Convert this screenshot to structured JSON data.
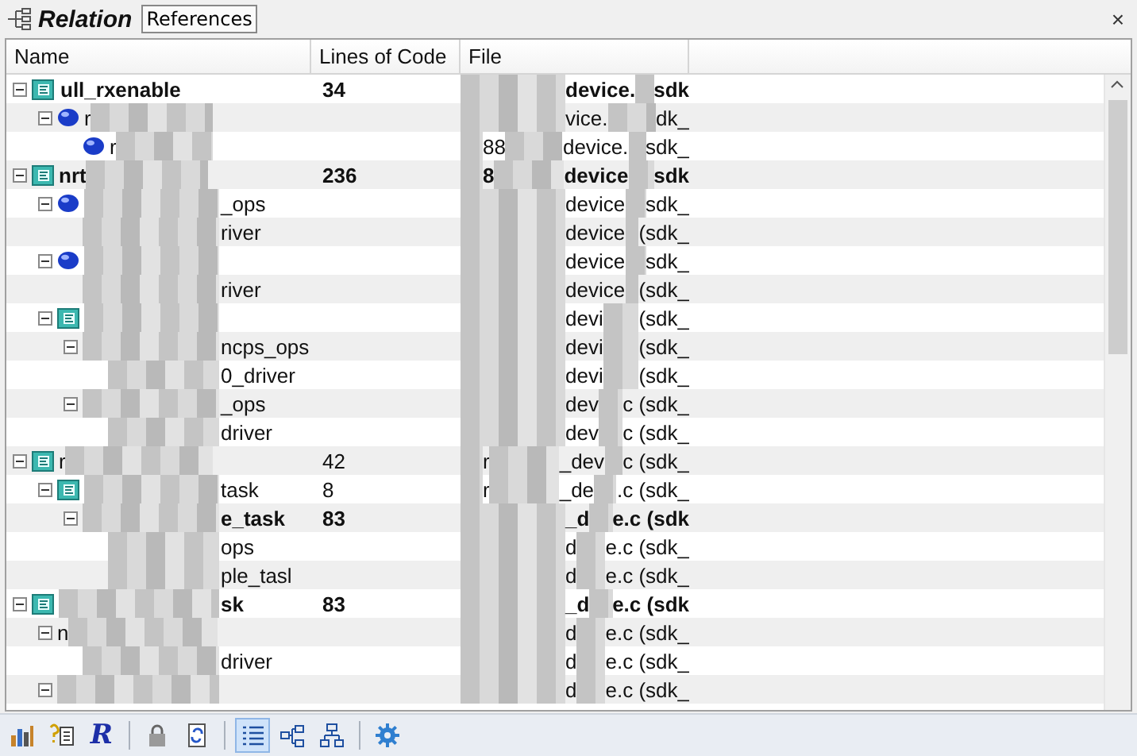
{
  "panel": {
    "title": "Relation",
    "tab": "References",
    "close": "×"
  },
  "columns": [
    "Name",
    "Lines of Code",
    "File"
  ],
  "tree": [
    {
      "kind": "struct",
      "expanded": true,
      "bold": true,
      "redacted": false,
      "name": "ull_rxenable",
      "lines": "34",
      "file": "device.",
      "file_tail": "sdk",
      "children": [
        {
          "kind": "function",
          "expanded": true,
          "bold": false,
          "redacted": true,
          "name_lead": "r",
          "file": "vice.",
          "file_tail": "dk_",
          "children": [
            {
              "kind": "function",
              "bold": false,
              "redacted": true,
              "name_lead": "r",
              "file_lead": "88",
              "file": "device.",
              "file_tail": "sdk_"
            }
          ]
        }
      ]
    },
    {
      "kind": "struct",
      "expanded": true,
      "bold": true,
      "redacted": true,
      "name_lead": "nrt",
      "lines": "236",
      "file_lead": "8",
      "file": "device",
      "file_tail": "sdk",
      "children": [
        {
          "kind": "function",
          "expanded": true,
          "bold": false,
          "redacted": true,
          "name": "_ops",
          "file": "device",
          "file_tail": "sdk_",
          "children": [
            {
              "bold": false,
              "redacted": true,
              "name": "river",
              "file": "device",
              "file_tail": "(sdk_"
            }
          ]
        },
        {
          "kind": "function",
          "expanded": true,
          "bold": false,
          "redacted": true,
          "file": "device",
          "file_tail": "sdk_",
          "children": [
            {
              "bold": false,
              "redacted": true,
              "name": "river",
              "file": "device",
              "file_tail": "(sdk_"
            }
          ]
        },
        {
          "kind": "struct",
          "expanded": true,
          "bold": false,
          "redacted": true,
          "file": "devi",
          "file_tail": "(sdk_",
          "children": [
            {
              "expanded": true,
              "bold": false,
              "redacted": true,
              "name": "ncps_ops",
              "file": "devi",
              "file_tail": "(sdk_",
              "children": [
                {
                  "bold": false,
                  "redacted": true,
                  "name": "0_driver",
                  "file": "devi",
                  "file_tail": "(sdk_"
                }
              ]
            },
            {
              "expanded": true,
              "bold": false,
              "redacted": true,
              "name": "_ops",
              "file": "dev",
              "file_tail": "c (sdk_",
              "children": [
                {
                  "bold": false,
                  "redacted": true,
                  "name": "driver",
                  "file": "dev",
                  "file_tail": "c (sdk_"
                }
              ]
            }
          ]
        }
      ]
    },
    {
      "kind": "struct",
      "expanded": true,
      "bold": false,
      "redacted": true,
      "name_lead": "r",
      "lines": "42",
      "file_lead": "r",
      "file": "_dev",
      "file_tail": "c (sdk_",
      "children": [
        {
          "kind": "struct",
          "expanded": true,
          "bold": false,
          "redacted": true,
          "name": "task",
          "lines": "8",
          "file_lead": "r",
          "file": "_de",
          "file_tail": ".c (sdk_",
          "children": [
            {
              "expanded": true,
              "bold": true,
              "redacted": true,
              "name": "e_task",
              "lines": "83",
              "file": "_d",
              "file_tail": "e.c (sdk",
              "children": [
                {
                  "bold": false,
                  "redacted": true,
                  "name": "ops",
                  "file": "d",
                  "file_tail": "e.c (sdk_"
                },
                {
                  "bold": false,
                  "redacted": true,
                  "name": "ple_tasl",
                  "file": "d",
                  "file_tail": "e.c (sdk_"
                }
              ]
            }
          ]
        }
      ]
    },
    {
      "kind": "struct",
      "expanded": true,
      "bold": true,
      "redacted": true,
      "name": "sk",
      "lines": "83",
      "file": "_d",
      "file_tail": "e.c (sdk",
      "children": [
        {
          "expanded": true,
          "bold": false,
          "redacted": true,
          "name_lead": "n",
          "file": "d",
          "file_tail": "e.c (sdk_",
          "children": [
            {
              "bold": false,
              "redacted": true,
              "name": "driver",
              "file": "d",
              "file_tail": "e.c (sdk_"
            }
          ]
        },
        {
          "expanded": true,
          "bold": false,
          "redacted": true,
          "file": "d",
          "file_tail": "e.c (sdk_"
        }
      ]
    }
  ],
  "toolbar": [
    {
      "kind": "chart",
      "selected": false
    },
    {
      "kind": "help",
      "selected": false
    },
    {
      "kind": "letter",
      "label": "R",
      "selected": false
    },
    {
      "kind": "separator"
    },
    {
      "kind": "lock",
      "selected": false
    },
    {
      "kind": "refresh",
      "selected": false
    },
    {
      "kind": "separator"
    },
    {
      "kind": "list",
      "selected": true
    },
    {
      "kind": "tree",
      "selected": false
    },
    {
      "kind": "hierarchy",
      "selected": false
    },
    {
      "kind": "separator"
    },
    {
      "kind": "gear",
      "selected": false
    }
  ]
}
